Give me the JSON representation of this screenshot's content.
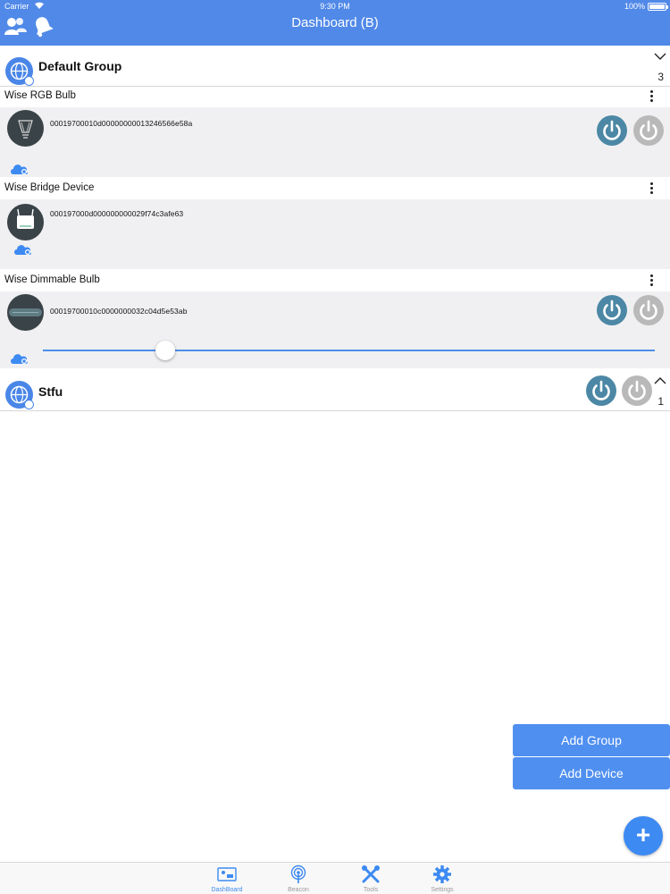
{
  "status_bar": {
    "carrier": "Carrier",
    "time": "9:30 PM",
    "battery": "100%"
  },
  "nav": {
    "title": "Dashboard (B)",
    "icons": [
      "users-icon",
      "bell-icon"
    ]
  },
  "groups": [
    {
      "name": "Default Group",
      "count": "3",
      "expanded": true,
      "devices": [
        {
          "name": "Wise RGB Bulb",
          "id": "00019700010d00000000013246566e58a",
          "icon": "bulb-icon",
          "has_power_buttons": true
        },
        {
          "name": "Wise Bridge Device",
          "id": "000197000d000000000029f74c3afe63",
          "icon": "bridge-icon",
          "has_power_buttons": false
        },
        {
          "name": "Wise Dimmable Bulb",
          "id": "00019700010c0000000032c04d5e53ab",
          "icon": "dimmable-bulb-icon",
          "has_power_buttons": true,
          "dimmer_level": 0.2
        }
      ]
    },
    {
      "name": "Stfu",
      "count": "1",
      "expanded": false
    }
  ],
  "actions": {
    "add_group": "Add Group",
    "add_device": "Add Device",
    "fab": "+"
  },
  "tabs": [
    {
      "label": "DashBoard",
      "icon": "dashboard-icon",
      "active": true
    },
    {
      "label": "Beacon",
      "icon": "beacon-icon",
      "active": false
    },
    {
      "label": "Tools",
      "icon": "tools-icon",
      "active": false
    },
    {
      "label": "Settings",
      "icon": "gear-icon",
      "active": false
    }
  ],
  "colors": {
    "nav_bar": "#5089e8",
    "power_on": "#4c88a5",
    "power_off": "#b9b9b9",
    "accent": "#3d8af2"
  }
}
